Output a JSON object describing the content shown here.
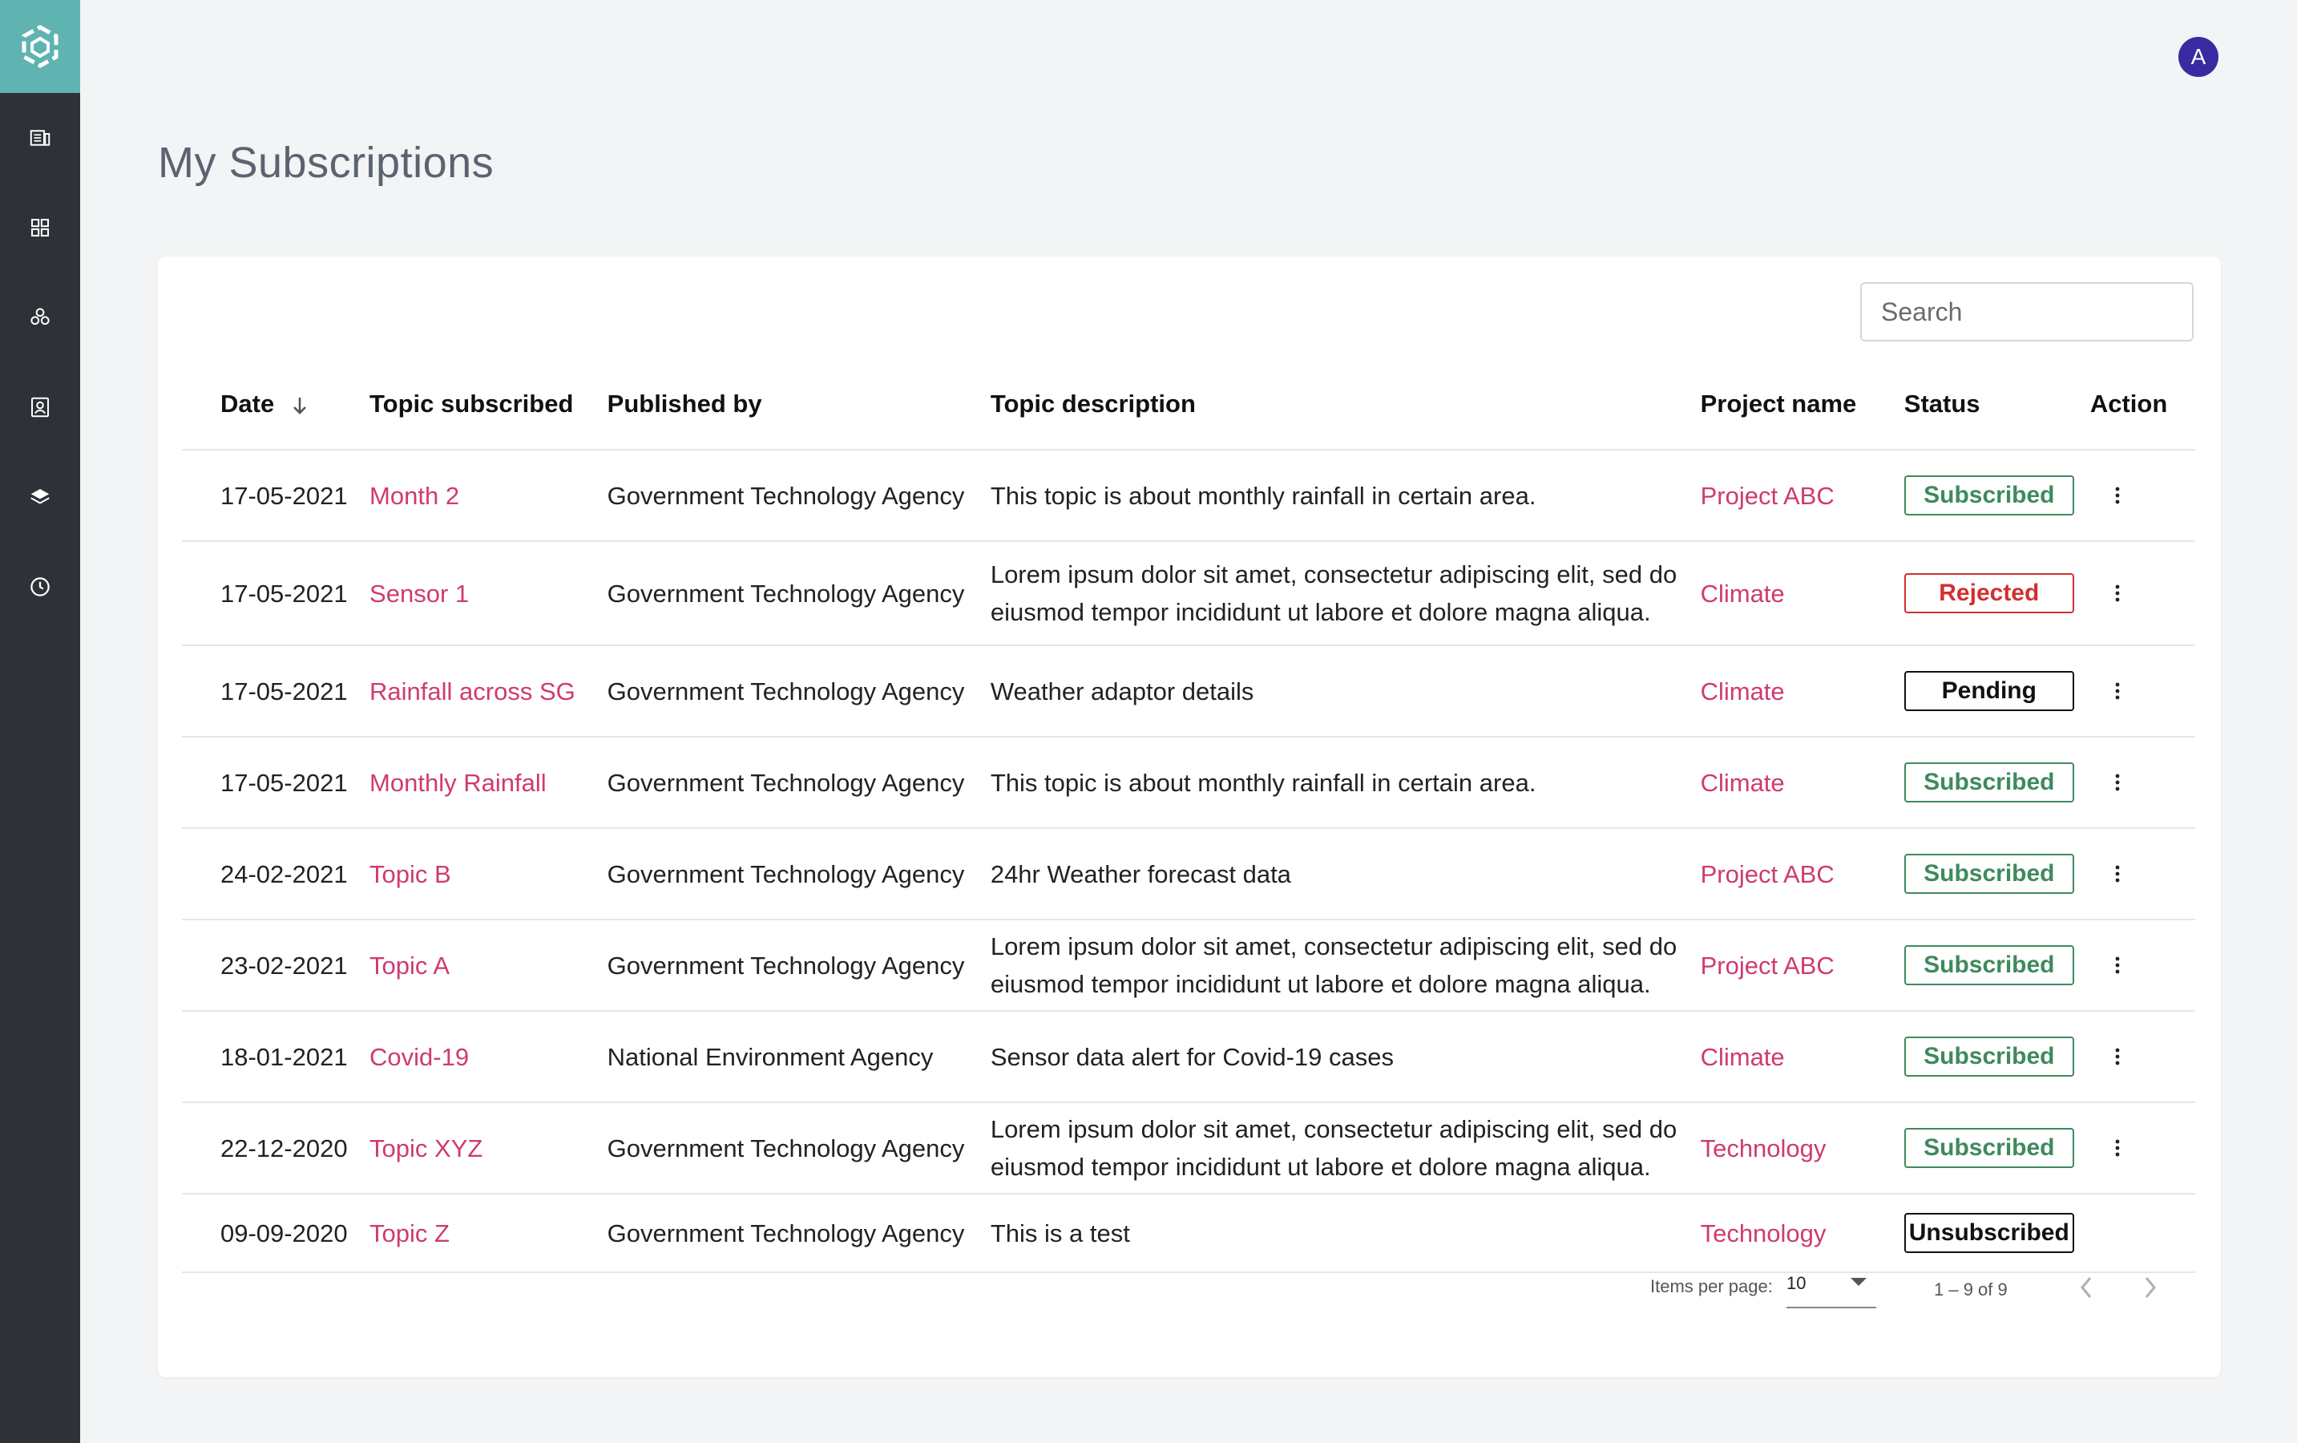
{
  "app": {
    "avatar_initial": "A",
    "accent_color": "#5fb3b0",
    "sidebar_color": "#2e3238",
    "link_color": "#cf3a72"
  },
  "sidebar": {
    "items": [
      {
        "icon": "news-icon"
      },
      {
        "icon": "grid-icon"
      },
      {
        "icon": "cluster-icon"
      },
      {
        "icon": "contact-card-icon"
      },
      {
        "icon": "layers-icon"
      },
      {
        "icon": "clock-icon"
      }
    ]
  },
  "page": {
    "title": "My Subscriptions"
  },
  "search": {
    "placeholder": "Search"
  },
  "table": {
    "headers": {
      "date": "Date",
      "topic": "Topic subscribed",
      "publisher": "Published by",
      "description": "Topic description",
      "project": "Project name",
      "status": "Status",
      "action": "Action"
    },
    "rows": [
      {
        "date": "17-05-2021",
        "topic": "Month 2",
        "publisher": "Government Technology Agency",
        "description": "This topic is about monthly rainfall in certain area.",
        "project": "Project ABC",
        "status": "Subscribed"
      },
      {
        "date": "17-05-2021",
        "topic": "Sensor 1",
        "publisher": "Government Technology Agency",
        "description": "Lorem ipsum dolor sit amet, consectetur adipiscing elit, sed do eiusmod tempor incididunt ut labore et dolore magna aliqua.",
        "project": "Climate",
        "status": "Rejected"
      },
      {
        "date": "17-05-2021",
        "topic": "Rainfall across SG",
        "publisher": "Government Technology Agency",
        "description": "Weather adaptor details",
        "project": "Climate",
        "status": "Pending"
      },
      {
        "date": "17-05-2021",
        "topic": "Monthly Rainfall",
        "publisher": "Government Technology Agency",
        "description": "This topic is about monthly rainfall in certain area.",
        "project": "Climate",
        "status": "Subscribed"
      },
      {
        "date": "24-02-2021",
        "topic": "Topic B",
        "publisher": "Government Technology Agency",
        "description": "24hr Weather forecast data",
        "project": "Project ABC",
        "status": "Subscribed"
      },
      {
        "date": "23-02-2021",
        "topic": "Topic A",
        "publisher": "Government Technology Agency",
        "description": "Lorem ipsum dolor sit amet, consectetur adipiscing elit, sed do eiusmod tempor incididunt ut labore et dolore magna aliqua.",
        "project": "Project ABC",
        "status": "Subscribed"
      },
      {
        "date": "18-01-2021",
        "topic": "Covid-19",
        "publisher": "National Environment Agency",
        "description": "Sensor data alert for Covid-19 cases",
        "project": "Climate",
        "status": "Subscribed"
      },
      {
        "date": "22-12-2020",
        "topic": "Topic XYZ",
        "publisher": "Government Technology Agency",
        "description": "Lorem ipsum dolor sit amet, consectetur adipiscing elit, sed do eiusmod tempor incididunt ut labore et dolore magna aliqua.",
        "project": "Technology",
        "status": "Subscribed"
      },
      {
        "date": "09-09-2020",
        "topic": "Topic Z",
        "publisher": "Government Technology Agency",
        "description": "This is a test",
        "project": "Technology",
        "status": "Unsubscribed"
      }
    ]
  },
  "paginator": {
    "label": "Items per page:",
    "page_size": "10",
    "range": "1 – 9 of 9"
  }
}
